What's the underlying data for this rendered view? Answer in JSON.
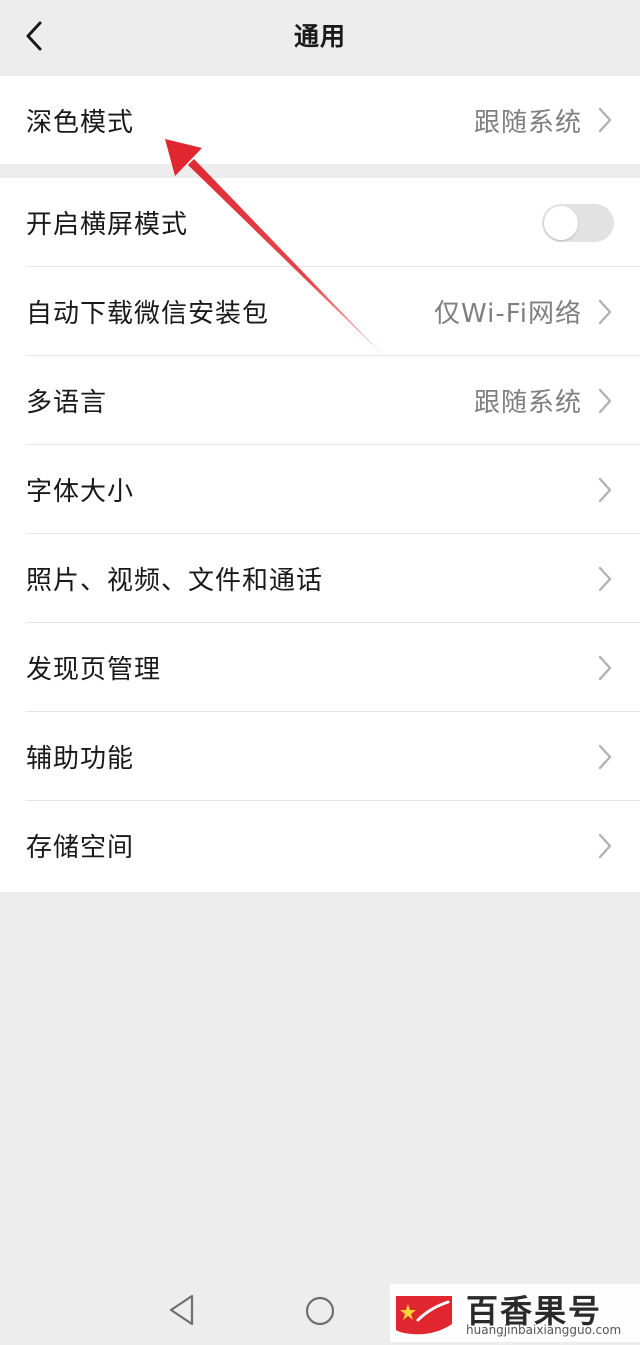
{
  "header": {
    "title": "通用",
    "back_icon": "chevron-left-icon"
  },
  "settings_group_1": [
    {
      "label": "深色模式",
      "value": "跟随系统",
      "type": "link"
    }
  ],
  "settings_group_2": [
    {
      "label": "开启横屏模式",
      "type": "toggle",
      "toggle_on": false
    },
    {
      "label": "自动下载微信安装包",
      "value": "仅Wi-Fi网络",
      "type": "link"
    },
    {
      "label": "多语言",
      "value": "跟随系统",
      "type": "link"
    },
    {
      "label": "字体大小",
      "type": "link"
    },
    {
      "label": "照片、视频、文件和通话",
      "type": "link"
    },
    {
      "label": "发现页管理",
      "type": "link"
    },
    {
      "label": "辅助功能",
      "type": "link"
    },
    {
      "label": "存储空间",
      "type": "link"
    }
  ],
  "annotation": {
    "icon": "red-arrow-annotation",
    "color": "#e0262e",
    "points_to": "深色模式"
  },
  "system_nav": {
    "back_icon": "triangle-back-icon",
    "home_icon": "circle-home-icon"
  },
  "watermark": {
    "title": "百香果号",
    "url": "huangjinbaixiangguo.com",
    "logo_icon": "red-flag-logo-icon"
  },
  "colors": {
    "background": "#ededed",
    "card": "#ffffff",
    "text": "#191919",
    "secondary_text": "#7f7f7f",
    "divider": "#e5e5e5",
    "accent_red": "#e0262e"
  }
}
